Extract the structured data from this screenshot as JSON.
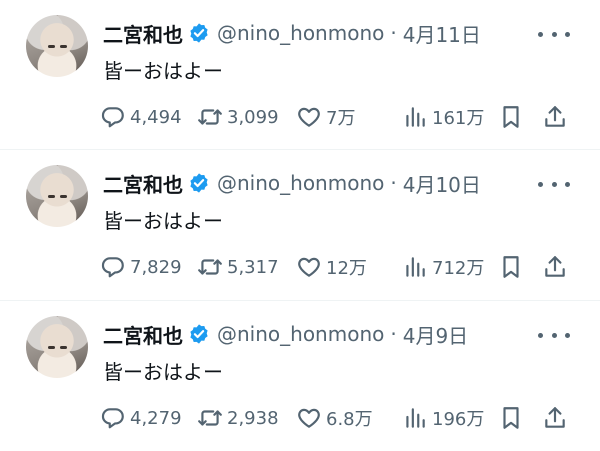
{
  "tweets": [
    {
      "name": "二宮和也",
      "handle": "@nino_honmono",
      "separator": "·",
      "date": "4月11日",
      "text": "皆ーおはよー",
      "replies": "4,494",
      "retweets": "3,099",
      "likes": "7万",
      "views": "161万"
    },
    {
      "name": "二宮和也",
      "handle": "@nino_honmono",
      "separator": "·",
      "date": "4月10日",
      "text": "皆ーおはよー",
      "replies": "7,829",
      "retweets": "5,317",
      "likes": "12万",
      "views": "712万"
    },
    {
      "name": "二宮和也",
      "handle": "@nino_honmono",
      "separator": "·",
      "date": "4月9日",
      "text": "皆ーおはよー",
      "replies": "4,279",
      "retweets": "2,938",
      "likes": "6.8万",
      "views": "196万"
    }
  ],
  "icons": {
    "verified": "verified-badge-icon",
    "more": "more-dots-icon",
    "reply": "reply-bubble-icon",
    "retweet": "retweet-arrows-icon",
    "like": "heart-icon",
    "views": "bar-chart-icon",
    "bookmark": "bookmark-icon",
    "share": "share-upload-icon"
  },
  "colors": {
    "verified_blue": "#1d9bf0",
    "secondary_text": "#536471",
    "primary_text": "#0f1419",
    "divider": "#eff3f4"
  }
}
